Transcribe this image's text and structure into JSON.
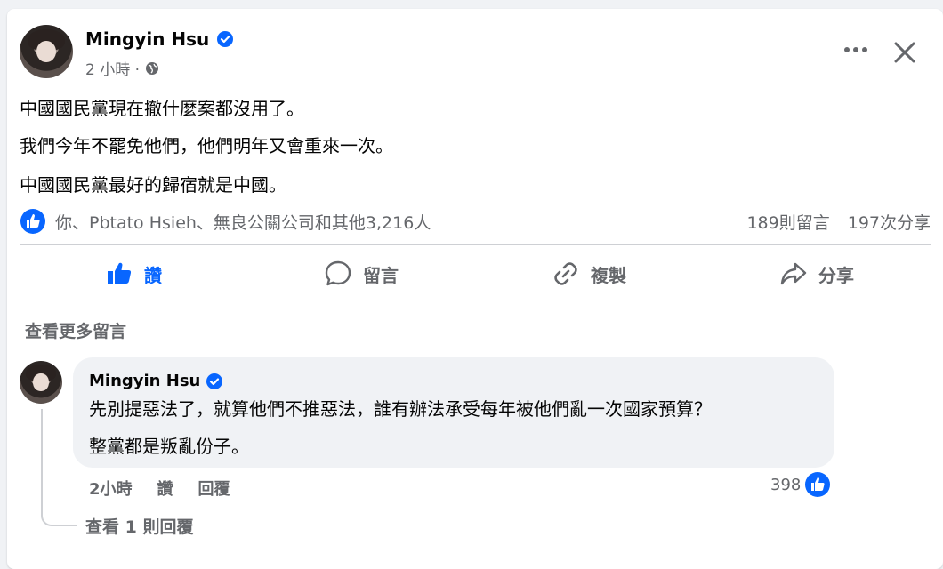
{
  "post": {
    "author": "Mingyin Hsu",
    "time": "2 小時 ·",
    "lines": [
      "中國國民黨現在撤什麼案都沒用了。",
      "我們今年不罷免他們，他們明年又會重來一次。",
      "中國國民黨最好的歸宿就是中國。"
    ],
    "reactions_text": "你、Pbtato Hsieh、無良公關公司和其他3,216人",
    "comments_count": "189則留言",
    "shares_count": "197次分享"
  },
  "actions": {
    "like": "讚",
    "comment": "留言",
    "copy": "複製",
    "share": "分享"
  },
  "view_more_comments": "查看更多留言",
  "comment": {
    "author": "Mingyin Hsu",
    "lines": [
      "先別提惡法了，就算他們不推惡法，誰有辦法承受每年被他們亂一次國家預算？",
      "整黨都是叛亂份子。"
    ],
    "time": "2小時",
    "like_label": "讚",
    "reply_label": "回覆",
    "reaction_count": "398",
    "view_replies": "查看 1 則回覆"
  },
  "colors": {
    "accent": "#0866ff",
    "secondary_text": "#65676b",
    "bubble": "#f0f2f5"
  }
}
